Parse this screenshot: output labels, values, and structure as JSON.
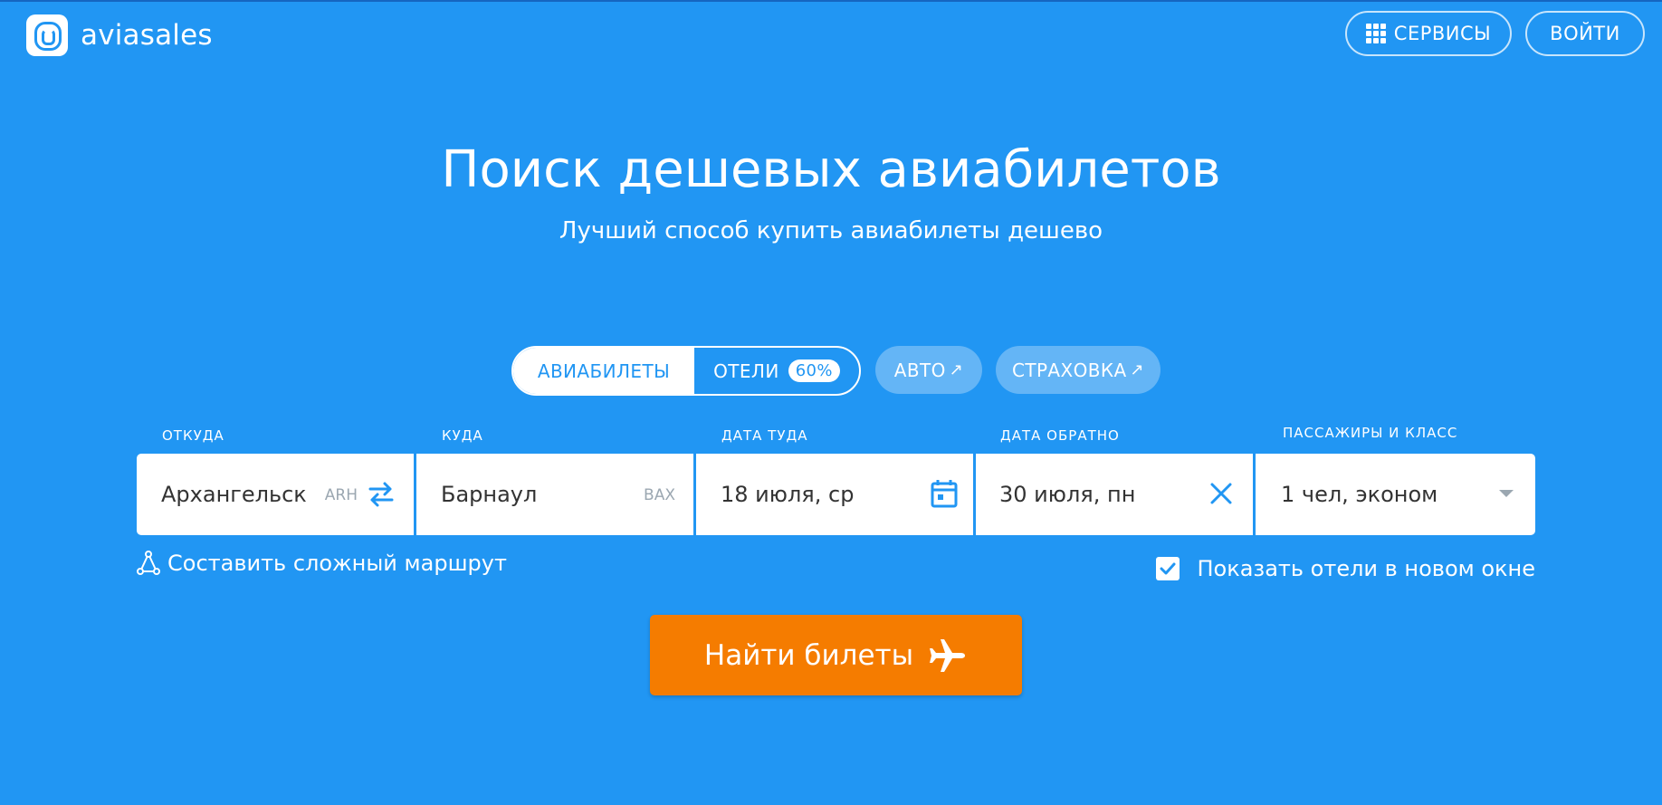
{
  "header": {
    "logo_text": "aviasales",
    "services_label": "СЕРВИСЫ",
    "login_label": "ВОЙТИ"
  },
  "hero": {
    "title": "Поиск дешевых авиабилетов",
    "subtitle": "Лучший способ купить авиабилеты дешево"
  },
  "tabs": {
    "avia": "АВИАБИЛЕТЫ",
    "hotels": "ОТЕЛИ",
    "hotels_badge": "60%",
    "auto": "АВТО",
    "insurance": "СТРАХОВКА",
    "external_arrow": "↗"
  },
  "search": {
    "from": {
      "label": "ОТКУДА",
      "value": "Архангельск",
      "code": "ARH"
    },
    "to": {
      "label": "КУДА",
      "value": "Барнаул",
      "code": "BAX"
    },
    "depart": {
      "label": "ДАТА ТУДА",
      "value": "18 июля, ср"
    },
    "return": {
      "label": "ДАТА ОБРАТНО",
      "value": "30 июля, пн"
    },
    "passengers": {
      "label": "ПАССАЖИРЫ И КЛАСС",
      "value": "1 чел, эконом"
    }
  },
  "options": {
    "complex_route": "Составить сложный маршрут",
    "show_hotels": "Показать отели в новом окне",
    "show_hotels_checked": true
  },
  "find_button": "Найти билеты",
  "colors": {
    "background": "#2196f3",
    "accent_button": "#f57c00",
    "icon_blue": "#2196f3",
    "placeholder_gray": "#9ba7b1"
  },
  "icons": {
    "logo": "aviasales-logo-icon",
    "services": "grid-icon",
    "swap": "swap-arrows-icon",
    "calendar": "calendar-icon",
    "clear": "close-icon",
    "dropdown": "chevron-down-icon",
    "route": "route-nodes-icon",
    "checkbox": "check-icon",
    "plane": "airplane-icon"
  }
}
